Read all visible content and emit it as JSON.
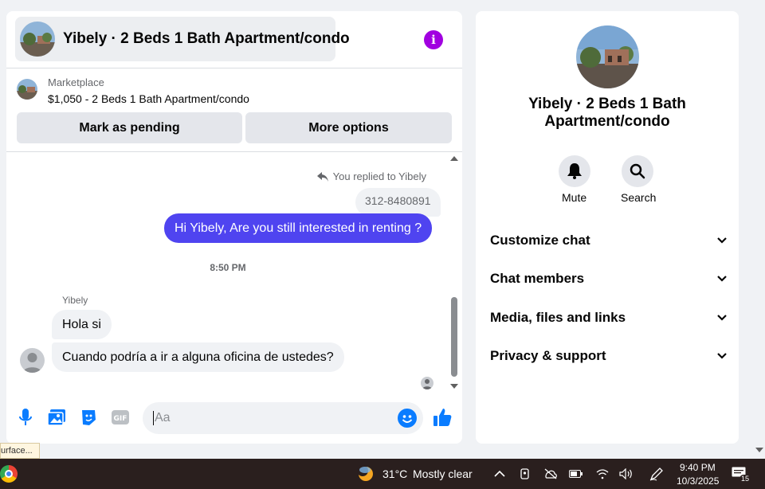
{
  "chat": {
    "title": "Yibely · 2 Beds 1 Bath Apartment/condo",
    "marketplace_label": "Marketplace",
    "listing": "$1,050 - 2 Beds 1 Bath Apartment/condo",
    "mark_pending_label": "Mark as pending",
    "more_options_label": "More options",
    "replied_text": "You replied to Yibely",
    "quoted_text": "312-8480891",
    "outgoing_message": "Hi Yibely, Are you still interested in renting ?",
    "timestamp": "8:50 PM",
    "sender_name": "Yibely",
    "incoming_messages": [
      "Hola si",
      "Cuando podría a ir a alguna oficina de ustedes?"
    ],
    "composer_placeholder": "Aa"
  },
  "info_panel": {
    "name": "Yibely · 2 Beds 1 Bath Apartment/condo",
    "mute_label": "Mute",
    "search_label": "Search",
    "sections": [
      "Customize chat",
      "Chat members",
      "Media, files and links",
      "Privacy & support"
    ]
  },
  "tooltip_text": "urface...",
  "taskbar": {
    "temperature": "31°C",
    "weather": "Mostly clear",
    "time": "9:40 PM",
    "date": "10/3/2025",
    "notification_count": "15"
  },
  "colors": {
    "accent": "#4f44f0",
    "info_purple": "#a100e0",
    "messenger_blue": "#0a7cff",
    "taskbar_bg": "#2a1f1e"
  }
}
